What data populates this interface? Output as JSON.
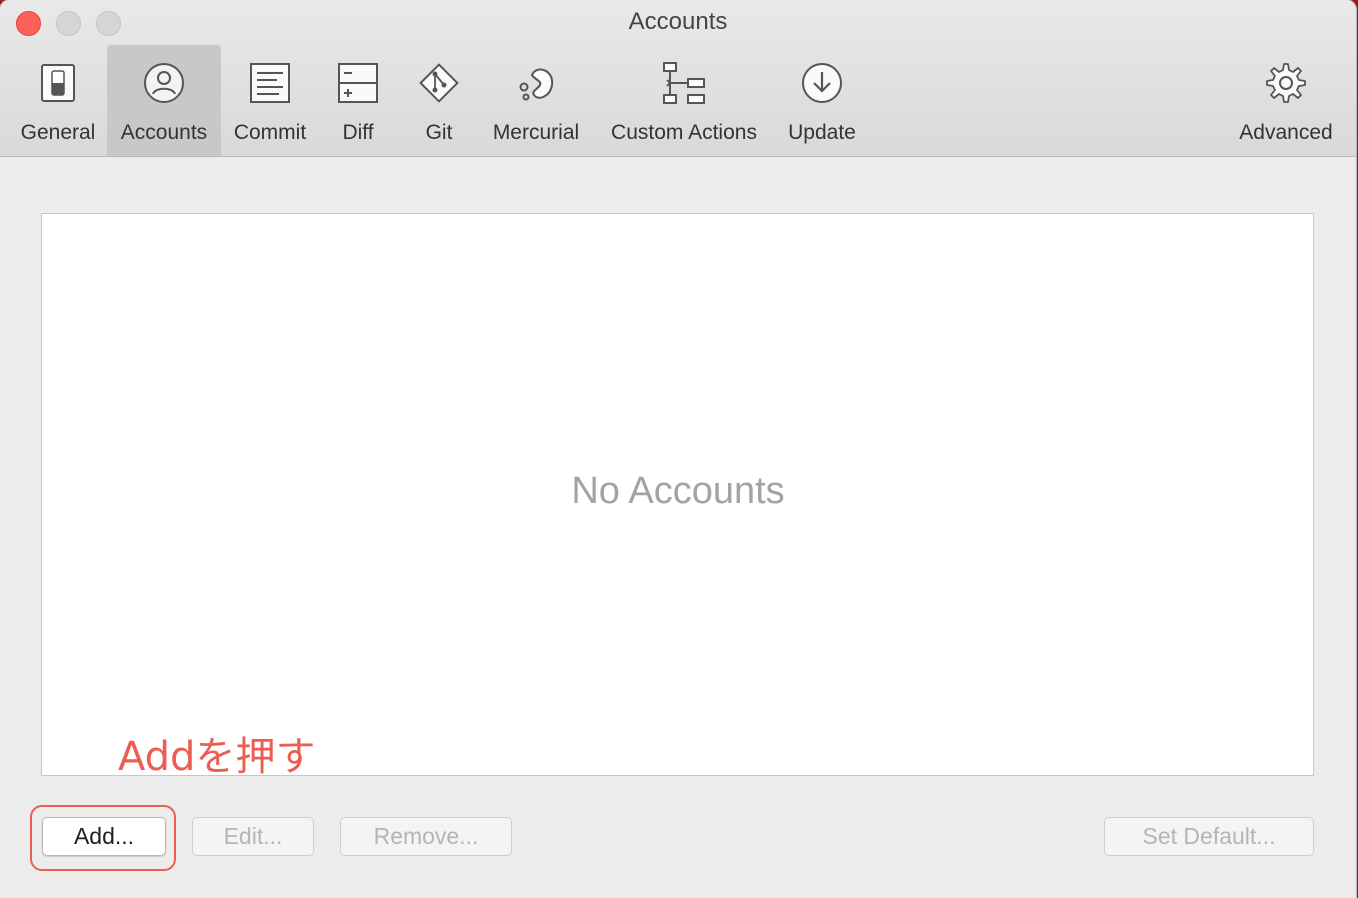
{
  "window": {
    "title": "Accounts"
  },
  "toolbar": {
    "tabs": [
      {
        "label": "General",
        "icon": "switch-icon"
      },
      {
        "label": "Accounts",
        "icon": "user-icon",
        "selected": true
      },
      {
        "label": "Commit",
        "icon": "document-icon"
      },
      {
        "label": "Diff",
        "icon": "diff-icon"
      },
      {
        "label": "Git",
        "icon": "git-icon"
      },
      {
        "label": "Mercurial",
        "icon": "mercurial-icon"
      },
      {
        "label": "Custom Actions",
        "icon": "flow-icon"
      },
      {
        "label": "Update",
        "icon": "download-icon"
      },
      {
        "label": "Advanced",
        "icon": "gear-icon"
      }
    ]
  },
  "accounts": {
    "empty_text": "No Accounts"
  },
  "annotation": {
    "text": "Addを押す",
    "color": "#ec5d52"
  },
  "buttons": {
    "add": "Add...",
    "edit": "Edit...",
    "remove": "Remove...",
    "set_default": "Set Default..."
  }
}
